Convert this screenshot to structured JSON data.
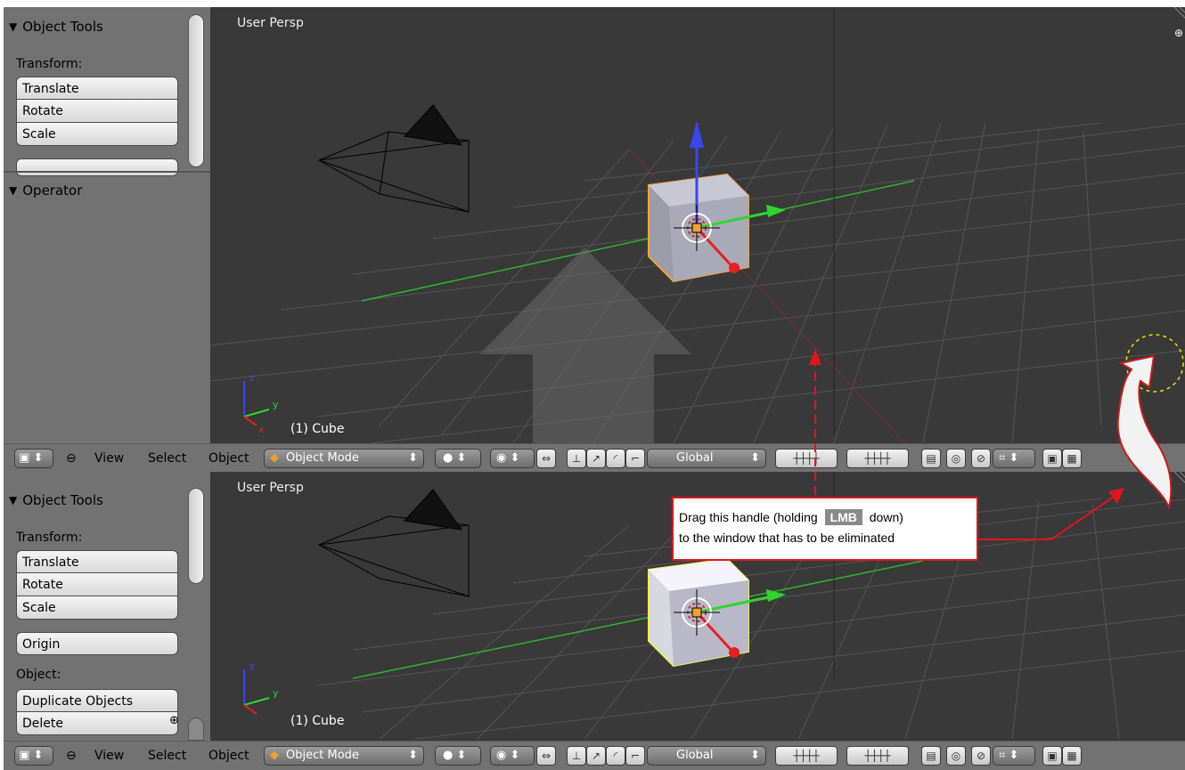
{
  "top_pane": {
    "toolshelf": {
      "object_tools_title": "Object Tools",
      "transform_label": "Transform:",
      "buttons": [
        "Translate",
        "Rotate",
        "Scale"
      ],
      "operator_title": "Operator"
    },
    "viewport": {
      "title": "User Persp",
      "object_label": "(1) Cube"
    }
  },
  "bottom_pane": {
    "toolshelf": {
      "object_tools_title": "Object Tools",
      "transform_label": "Transform:",
      "buttons": [
        "Translate",
        "Rotate",
        "Scale"
      ],
      "origin_button": "Origin",
      "object_label": "Object:",
      "object_buttons": [
        "Duplicate Objects",
        "Delete"
      ]
    },
    "viewport": {
      "title": "User Persp",
      "object_label": "(1) Cube"
    }
  },
  "header": {
    "menu": [
      "View",
      "Select",
      "Object"
    ],
    "mode": "Object Mode",
    "orientation": "Global"
  },
  "callout": {
    "text_before": "Drag this handle (holding",
    "key": "LMB",
    "text_after": "down)",
    "line2": "to the window that has to be eliminated"
  },
  "colors": {
    "accent": "#e0161b",
    "viewport_bg": "#393939",
    "shelf_bg": "#727272"
  }
}
